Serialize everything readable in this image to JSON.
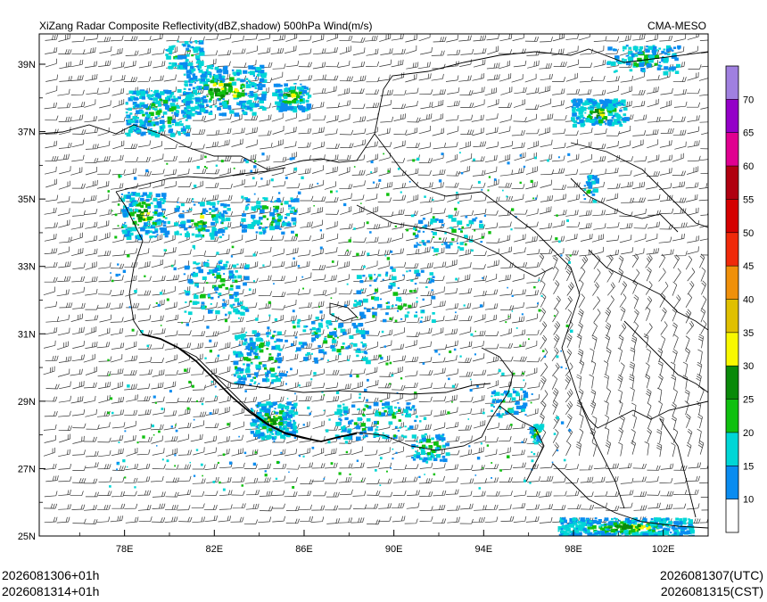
{
  "title": "XiZang Radar Composite Reflectivity(dBZ,shadow) 500hPa Wind(m/s)",
  "source": "CMA-MESO",
  "footer": {
    "left_line1": "2026081306+01h",
    "left_line2": "2026081314+01h",
    "right_line1": "2026081307(UTC)",
    "right_line2": "2026081315(CST)"
  },
  "axes": {
    "lat_labels": [
      "39N",
      "37N",
      "35N",
      "33N",
      "31N",
      "29N",
      "27N",
      "25N"
    ],
    "lat_values": [
      39,
      37,
      35,
      33,
      31,
      29,
      27,
      25
    ],
    "lon_labels": [
      "78E",
      "82E",
      "86E",
      "90E",
      "94E",
      "98E",
      "102E"
    ],
    "lon_values": [
      78,
      82,
      86,
      90,
      94,
      98,
      102
    ],
    "lon_range": [
      74.2,
      104.0
    ],
    "lat_range": [
      25.0,
      39.9
    ]
  },
  "colorbar": {
    "labels": [
      "10",
      "15",
      "20",
      "25",
      "30",
      "35",
      "40",
      "45",
      "50",
      "55",
      "60",
      "65",
      "70"
    ],
    "colors": [
      "#ffffff",
      "#0a8cf0",
      "#00d6d6",
      "#10c010",
      "#0a8a0a",
      "#f8f800",
      "#e0c000",
      "#f0900a",
      "#f02a0a",
      "#d40000",
      "#b00010",
      "#e00090",
      "#9400c8",
      "#a080e0"
    ]
  }
}
